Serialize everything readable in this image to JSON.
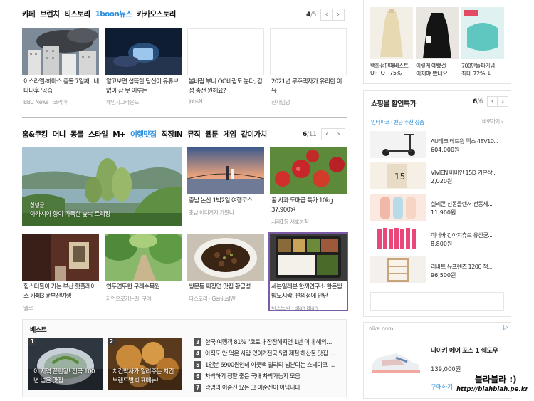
{
  "top_tabs": {
    "items": [
      "카페",
      "브런치",
      "티스토리",
      "1boon뉴스",
      "카카오스토리"
    ],
    "active_index": 3,
    "active_color": "#2a8fe0",
    "page_current": "4",
    "page_total": "/5"
  },
  "top_cards": [
    {
      "title": "이스라엘-하마스 충돌 7일째.. 네타냐후 '공습",
      "source": "BBC News | 코리아"
    },
    {
      "title": "알고보면 섬뜩한 당신이 유튜브 없이 잠 못 이루는",
      "source": "체인지그라운드"
    },
    {
      "title": "봄바람 부니 OO바람도 분다, 감성 충전 원해요?",
      "source": "jobsN"
    },
    {
      "title": "2021년 무주택자가 유리한 이유",
      "source": "신사임당"
    }
  ],
  "life_tabs": {
    "items": [
      "홈&쿠킹",
      "머니",
      "동물",
      "스타일",
      "M+",
      "여행맛집",
      "직장IN",
      "뮤직",
      "웹툰",
      "게임",
      "같이가치"
    ],
    "active_index": 5,
    "page_current": "6",
    "page_total": "/11"
  },
  "big_card": {
    "title": "아카시아 향이 가득한 숲속 트레킹",
    "source": "창녕군"
  },
  "life_cards": [
    {
      "title": "충남 논산 1박2일 여행코스",
      "source": "충남 어디까지 가봤니"
    },
    {
      "title": "꿀 사과 도매급 특가 10kg 37,900원",
      "source": "시라1등 서호농장"
    },
    {
      "title": "힙스터들이 가는 부산 핫플레이스 카페3 #부산여행",
      "source": "엘르"
    },
    {
      "title": "연두연두한 구례수목원",
      "source": "자연으로가는길, 구례"
    },
    {
      "title": "쌍문동 짜장면 맛집 황금성",
      "source": "티스토리 · GeniusJW"
    },
    {
      "title": "세븐일레븐 한끼연구소 한돈쌈밥도시락, 편의점에 만난",
      "source": "티스토리 · Blah Blah"
    }
  ],
  "best": {
    "title": "베스트",
    "featured": [
      {
        "rank": "1",
        "text": "이 지역 끝판왕! 전국 100년 넘은 맛집..."
      },
      {
        "rank": "2",
        "text": "치킨박사가 알려주는 치킨브랜드별 대표메뉴!"
      }
    ],
    "list": [
      {
        "rank": "3",
        "text": "한국 여행객 81% \"코로나 잠잠해지면 1년 이내 해외…"
      },
      {
        "rank": "4",
        "text": "아직도 안 먹은 사람 있어? 전국 5월 제철 해산물 맛집 …"
      },
      {
        "rank": "5",
        "text": "1인분 6900원인데 아웃백 퀄리티 넘본다는 스테이크 …"
      },
      {
        "rank": "6",
        "text": "차박하기 정말 좋은 국내 차박가능지 모음"
      },
      {
        "rank": "7",
        "text": "광명의 이순신 묘는 그 이순신이 아닙니다"
      }
    ]
  },
  "shop_top": [
    {
      "title": "백화점판매베스트",
      "price": "UPTO~75%"
    },
    {
      "title": "이렇게 예뻤걸",
      "price": "이제야 봤네요"
    },
    {
      "title": "700만돌파기념",
      "price": "최대 72% ↓"
    }
  ],
  "sale": {
    "title": "쇼핑몰 할인특가",
    "page_current": "6",
    "page_total": "/6",
    "sub_link": "인터파크 · 밴딩 추천 상품",
    "more_link": "바로가기 ›",
    "items": [
      {
        "name": "AU테크 레드윙 엑스 48V10...",
        "price": "604,000원"
      },
      {
        "name": "VIVIEN 비비안 15D 기본삭...",
        "price": "2,020원"
      },
      {
        "name": "실리콘 진동클렌저 전동세...",
        "price": "11,900원"
      },
      {
        "name": "이너바 강아지츄르 유산균...",
        "price": "8,800원"
      },
      {
        "name": "리바트 뉴프렌즈 1200 책...",
        "price": "96,500원"
      }
    ]
  },
  "ad": {
    "domain": "nike.com",
    "title": "나이키 에어 포스 1 쉐도우",
    "price": "139,000원",
    "buy": "구매하기",
    "ad_mark": "▷"
  },
  "watermark": {
    "line1": "블라블라 :)",
    "line2": "http://blahblah.pe.kr"
  }
}
